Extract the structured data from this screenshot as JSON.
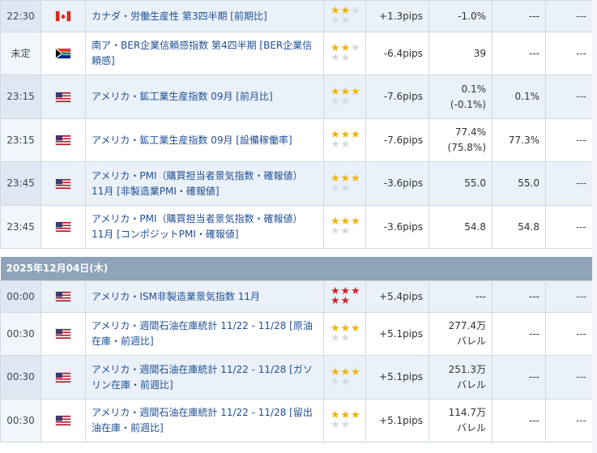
{
  "colors": {
    "gold_star": "#f0b400",
    "red_star": "#d4202a",
    "empty_star": "#d3dae3",
    "date_bar": "#8da4b9",
    "link_text": "#1f4f94"
  },
  "rows_before": [
    {
      "time": "22:30",
      "flag": "canada-flag-icon",
      "name": "カナダ・労働生産性 第3四半期 [前期比]",
      "stars": 2,
      "red": false,
      "pips": "+1.3pips",
      "result": "-1.0%",
      "forecast": "---",
      "previous": "---",
      "h": 39
    },
    {
      "time": "未定",
      "flag": "south-africa-flag-icon",
      "name": "南ア・BER企業信頼感指数 第4四半期 [BER企業信頼感]",
      "stars": 2,
      "red": false,
      "pips": "-6.4pips",
      "result": "39",
      "forecast": "---",
      "previous": "---",
      "h": 53
    },
    {
      "time": "23:15",
      "flag": "usa-flag-icon",
      "name": "アメリカ・鉱工業生産指数 09月 [前月比]",
      "stars": 3,
      "red": false,
      "pips": "-7.6pips",
      "result": "0.1%\n(-0.1%)",
      "forecast": "0.1%",
      "previous": "---",
      "h": 54
    },
    {
      "time": "23:15",
      "flag": "usa-flag-icon",
      "name": "アメリカ・鉱工業生産指数 09月 [設備稼働率]",
      "stars": 3,
      "red": false,
      "pips": "-7.6pips",
      "result": "77.4%\n(75.8%)",
      "forecast": "77.3%",
      "previous": "---",
      "h": 53
    },
    {
      "time": "23:45",
      "flag": "usa-flag-icon",
      "name": "アメリカ・PMI（購買担当者景気指数・確報値） 11月 [非製造業PMI・確報値]",
      "stars": 3,
      "red": false,
      "pips": "-3.6pips",
      "result": "55.0",
      "forecast": "55.0",
      "previous": "---",
      "h": 54
    },
    {
      "time": "23:45",
      "flag": "usa-flag-icon",
      "name": "アメリカ・PMI（購買担当者景気指数・確報値） 11月 [コンポジットPMI・確報値]",
      "stars": 3,
      "red": false,
      "pips": "-3.6pips",
      "result": "54.8",
      "forecast": "54.8",
      "previous": "---",
      "h": 53
    }
  ],
  "date_header": "2025年12月04日(木)",
  "rows_after": [
    {
      "time": "00:00",
      "flag": "usa-flag-icon",
      "name": "アメリカ・ISM非製造業景気指数 11月",
      "stars": 5,
      "red": true,
      "pips": "+5.4pips",
      "result": "---",
      "forecast": "---",
      "previous": "---",
      "h": 39
    },
    {
      "time": "00:30",
      "flag": "usa-flag-icon",
      "name": "アメリカ・週間石油在庫統計 11/22 - 11/28 [原油在庫・前週比]",
      "stars": 3,
      "red": false,
      "pips": "+5.1pips",
      "result": "277.4万\nバレル",
      "forecast": "---",
      "previous": "---",
      "h": 53
    },
    {
      "time": "00:30",
      "flag": "usa-flag-icon",
      "name": "アメリカ・週間石油在庫統計 11/22 - 11/28 [ガソリン在庫・前週比]",
      "stars": 3,
      "red": false,
      "pips": "+5.1pips",
      "result": "251.3万\nバレル",
      "forecast": "---",
      "previous": "---",
      "h": 54
    },
    {
      "time": "00:30",
      "flag": "usa-flag-icon",
      "name": "アメリカ・週間石油在庫統計 11/22 - 11/28 [留出油在庫・前週比]",
      "stars": 3,
      "red": false,
      "pips": "+5.1pips",
      "result": "114.7万\nバレル",
      "forecast": "---",
      "previous": "---",
      "h": 53
    }
  ]
}
